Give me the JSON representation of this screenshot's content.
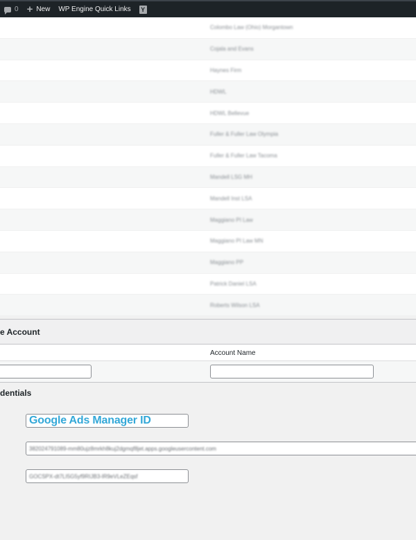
{
  "adminbar": {
    "comments_count": "0",
    "new_label": "New",
    "quick_links_label": "WP Engine Quick Links",
    "yoast_letter": "Y"
  },
  "accounts_list": [
    "Colombo Law (Ohio) Morgantown",
    "Cojala and Evans",
    "Haynes Firm",
    "HDWL",
    "HDWL Bellevue",
    "Fuller & Fuller Law Olympia",
    "Fuller & Fuller Law Tacoma",
    "Mandell LSG MH",
    "Mandell Inst LSA",
    "Maggiano PI Law",
    "Maggiano PI Law MN",
    "Maggiano PP",
    "Patrick Daniel LSA",
    "Roberts Wilson LSA"
  ],
  "add_account": {
    "section_title": "e Account",
    "column_account_name": "Account Name"
  },
  "credentials": {
    "section_title": "dentials",
    "manager_id_label": "Google Ads Manager ID",
    "client_id_value": "382024791089-mm80ujz8mrkh8kuj2dgmqf8jet.apps.googleusercontent.com",
    "client_secret_value": "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f"
  },
  "colors": {
    "adminbar_bg": "#1d2327",
    "accent_title": "#33a8d8"
  }
}
